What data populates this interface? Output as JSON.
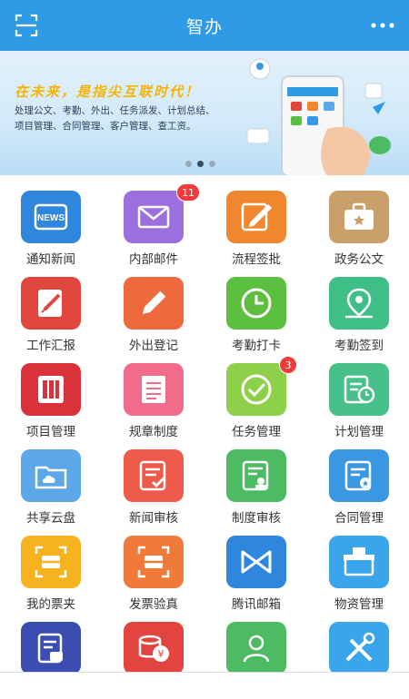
{
  "header": {
    "title": "智办",
    "scan_icon": "scan-icon",
    "more_icon": "more-icon"
  },
  "banner": {
    "slogan": "在未来，是指尖互联时代！",
    "description_line1": "处理公文、考勤、外出、任务派发、计划总结、",
    "description_line2": "项目管理、合同管理、客户管理、查工资。",
    "slides": 3,
    "active_slide": 2
  },
  "apps": [
    {
      "label": "通知新闻",
      "icon": "news-icon",
      "color": "#2f86dd"
    },
    {
      "label": "内部邮件",
      "icon": "mail-icon",
      "color": "#9c6fde",
      "badge": "11"
    },
    {
      "label": "流程签批",
      "icon": "edit-sign-icon",
      "color": "#f0872e"
    },
    {
      "label": "政务公文",
      "icon": "briefcase-icon",
      "color": "#c9a06a"
    },
    {
      "label": "工作汇报",
      "icon": "report-icon",
      "color": "#e0463d"
    },
    {
      "label": "外出登记",
      "icon": "pencil-icon",
      "color": "#ee6a3c"
    },
    {
      "label": "考勤打卡",
      "icon": "clock-icon",
      "color": "#5cbf3f"
    },
    {
      "label": "考勤签到",
      "icon": "location-icon",
      "color": "#3fbf86"
    },
    {
      "label": "项目管理",
      "icon": "project-icon",
      "color": "#d9323a"
    },
    {
      "label": "规章制度",
      "icon": "rules-doc-icon",
      "color": "#f06c8a"
    },
    {
      "label": "任务管理",
      "icon": "check-circle-icon",
      "color": "#8ed04a",
      "badge": "3"
    },
    {
      "label": "计划管理",
      "icon": "plan-calendar-icon",
      "color": "#48c08a"
    },
    {
      "label": "共享云盘",
      "icon": "cloud-folder-icon",
      "color": "#5ba7e8"
    },
    {
      "label": "新闻审核",
      "icon": "doc-check-icon",
      "color": "#ef5b4a"
    },
    {
      "label": "制度审核",
      "icon": "doc-stamp-icon",
      "color": "#4dbb62"
    },
    {
      "label": "合同管理",
      "icon": "contract-icon",
      "color": "#3a98e3"
    },
    {
      "label": "我的票夹",
      "icon": "ticket-scan-icon",
      "color": "#f6b21f"
    },
    {
      "label": "发票验真",
      "icon": "invoice-scan-icon",
      "color": "#f07a3a"
    },
    {
      "label": "腾讯邮箱",
      "icon": "tencent-mail-icon",
      "color": "#2f86dd"
    },
    {
      "label": "物资管理",
      "icon": "supplies-box-icon",
      "color": "#3aa5ea"
    },
    {
      "label": "",
      "icon": "invoice-doc-icon",
      "color": "#3b4db0"
    },
    {
      "label": "",
      "icon": "coins-icon",
      "color": "#e2453f"
    },
    {
      "label": "",
      "icon": "contacts-icon",
      "color": "#4dbb62"
    },
    {
      "label": "",
      "icon": "tools-icon",
      "color": "#3aa5ea"
    }
  ]
}
